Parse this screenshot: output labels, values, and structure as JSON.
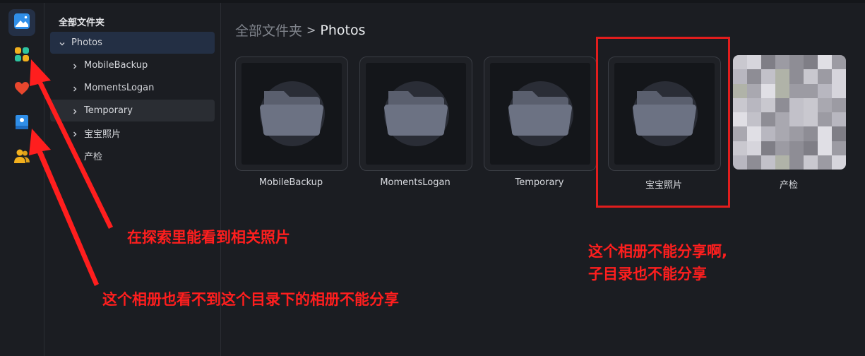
{
  "tree": {
    "title": "全部文件夹",
    "items": [
      {
        "label": "Photos"
      },
      {
        "label": "MobileBackup"
      },
      {
        "label": "MomentsLogan"
      },
      {
        "label": "Temporary"
      },
      {
        "label": "宝宝照片"
      },
      {
        "label": "产检"
      }
    ]
  },
  "breadcrumb": {
    "root": "全部文件夹",
    "separator": ">",
    "current": "Photos"
  },
  "albums": [
    {
      "label": "MobileBackup"
    },
    {
      "label": "MomentsLogan"
    },
    {
      "label": "Temporary"
    },
    {
      "label": "宝宝照片"
    },
    {
      "label": "产检"
    }
  ],
  "annotations": {
    "explore": "在探索里能看到相关照片",
    "album_cannot_see": "这个相册也看不到这个目录下的相册不能分享",
    "cannot_share_line1": "这个相册不能分享啊,",
    "cannot_share_line2": "子目录也不能分享"
  },
  "colors": {
    "accent": "#2b78d8",
    "annotation_red": "#ff1e1e",
    "background": "#1b1d22"
  },
  "icons": [
    "photos-app-icon",
    "explore-icon",
    "favorites-heart-icon",
    "album-icon",
    "people-icon",
    "folder-icon",
    "chevron-right-icon",
    "chevron-down-icon"
  ]
}
